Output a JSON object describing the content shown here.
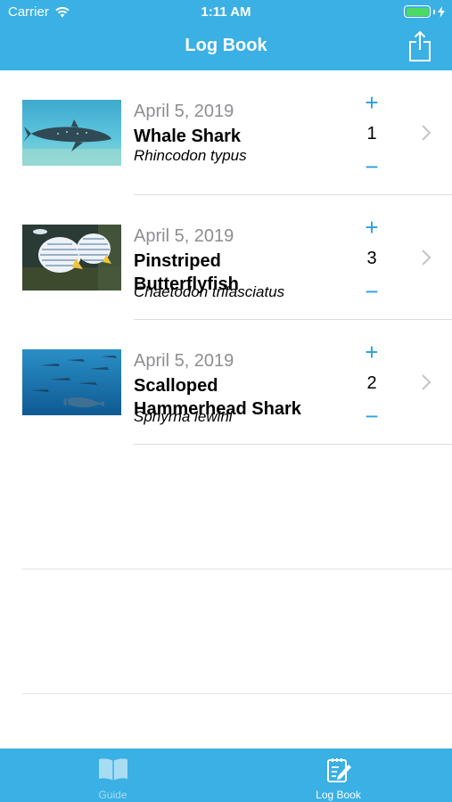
{
  "status": {
    "carrier": "Carrier",
    "time": "1:11 AM"
  },
  "nav": {
    "title": "Log Book",
    "share_icon": "share-icon"
  },
  "entries": [
    {
      "date": "April 5, 2019",
      "common_name": "Whale Shark",
      "scientific_name": "Rhincodon typus",
      "count": "1"
    },
    {
      "date": "April 5, 2019",
      "common_name": "Pinstriped Butterflyfish",
      "scientific_name": "Chaetodon trifasciatus",
      "count": "3"
    },
    {
      "date": "April 5, 2019",
      "common_name": "Scalloped Hammerhead Shark",
      "scientific_name": "Sphyrna lewini",
      "count": "2"
    }
  ],
  "controls": {
    "plus": "+",
    "minus": "−"
  },
  "tabs": [
    {
      "label": "Guide",
      "icon": "book-icon",
      "selected": false
    },
    {
      "label": "Log Book",
      "icon": "log-book-icon",
      "selected": true
    }
  ],
  "colors": {
    "bar": "#3ab0e4",
    "accent": "#2a9fdc",
    "tab_inactive": "#a7dcf3",
    "tab_active": "#ffffff"
  }
}
